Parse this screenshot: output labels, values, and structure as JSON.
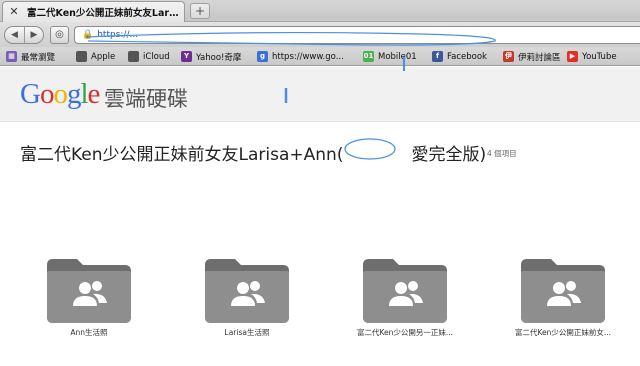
{
  "tab": {
    "title": "富二代Ken少公開正妹前女友Larisa…",
    "close_glyph": "✕",
    "new_tab_glyph": "+"
  },
  "toolbar": {
    "back_glyph": "◀",
    "forward_glyph": "▶",
    "site_glyph": "◎",
    "lock_glyph": "🔒",
    "url": "https://..."
  },
  "bookmarks": [
    {
      "label": "最常瀏覽",
      "icon": "most-visited-icon",
      "color": "#7a5fb0",
      "glyph": "▦"
    },
    {
      "label": "Apple",
      "icon": "apple-icon",
      "color": "#555555",
      "glyph": ""
    },
    {
      "label": "iCloud",
      "icon": "apple-icon",
      "color": "#555555",
      "glyph": ""
    },
    {
      "label": "Yahoo!奇摩",
      "icon": "yahoo-icon",
      "color": "#6f2c91",
      "glyph": "Y"
    },
    {
      "label": "https://www.go...",
      "icon": "google-icon",
      "color": "#3a6fd8",
      "glyph": "g"
    },
    {
      "label": "Mobile01",
      "icon": "mobile01-icon",
      "color": "#4caf50",
      "glyph": "01"
    },
    {
      "label": "Facebook",
      "icon": "facebook-icon",
      "color": "#3b5998",
      "glyph": "f"
    },
    {
      "label": "伊莉討論區",
      "icon": "eyny-icon",
      "color": "#c0392b",
      "glyph": "伊"
    },
    {
      "label": "YouTube",
      "icon": "youtube-icon",
      "color": "#e52d27",
      "glyph": "▶"
    }
  ],
  "header": {
    "logo_letters": [
      {
        "ch": "G",
        "color": "#3b6fdc"
      },
      {
        "ch": "o",
        "color": "#d8302c"
      },
      {
        "ch": "o",
        "color": "#f0b400"
      },
      {
        "ch": "g",
        "color": "#3b6fdc"
      },
      {
        "ch": "l",
        "color": "#2fa44f"
      },
      {
        "ch": "e",
        "color": "#d8302c"
      }
    ],
    "product": "雲端硬碟"
  },
  "folder": {
    "title": "富二代Ken少公開正妹前女友Larisa+Ann(　　　　愛完全版)",
    "item_count": "4 個項目"
  },
  "items": [
    {
      "name": "Ann生活照"
    },
    {
      "name": "Larisa生活照"
    },
    {
      "name": "富二代Ken少公開另一正妹..."
    },
    {
      "name": "富二代Ken少公開正妹前女..."
    }
  ],
  "colors": {
    "folder": "#8e8e8e",
    "folder_tab": "#6e6e6e",
    "scribble": "#4a90e2"
  }
}
